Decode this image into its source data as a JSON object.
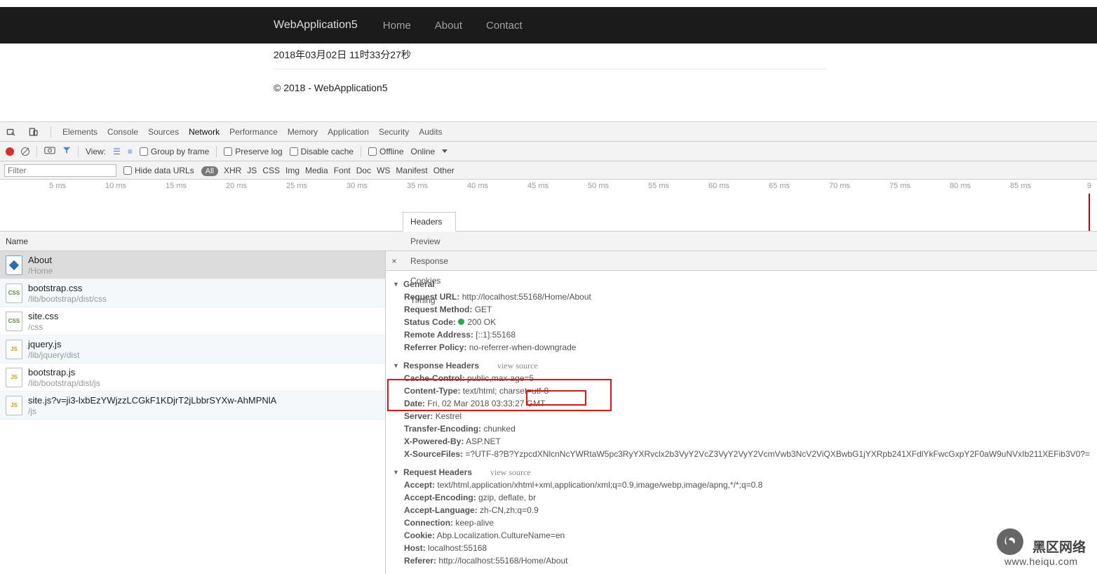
{
  "app": {
    "brand": "WebApplication5",
    "nav": [
      "Home",
      "About",
      "Contact"
    ],
    "timestamp": "2018年03月02日 11时33分27秒",
    "footer": "© 2018 - WebApplication5"
  },
  "devtools": {
    "tabs": [
      "Elements",
      "Console",
      "Sources",
      "Network",
      "Performance",
      "Memory",
      "Application",
      "Security",
      "Audits"
    ],
    "active_tab": "Network",
    "toolbar": {
      "view_label": "View:",
      "group_by_frame": "Group by frame",
      "preserve_log": "Preserve log",
      "disable_cache": "Disable cache",
      "offline": "Offline",
      "online": "Online"
    },
    "filter": {
      "placeholder": "Filter",
      "hide_data_urls": "Hide data URLs",
      "types": [
        "All",
        "XHR",
        "JS",
        "CSS",
        "Img",
        "Media",
        "Font",
        "Doc",
        "WS",
        "Manifest",
        "Other"
      ],
      "active_type": "All"
    },
    "timeline": [
      "5 ms",
      "10 ms",
      "15 ms",
      "20 ms",
      "25 ms",
      "30 ms",
      "35 ms",
      "40 ms",
      "45 ms",
      "50 ms",
      "55 ms",
      "60 ms",
      "65 ms",
      "70 ms",
      "75 ms",
      "80 ms",
      "85 ms",
      "9"
    ],
    "name_header": "Name",
    "requests": [
      {
        "name": "About",
        "sub": "/Home",
        "type": "doc"
      },
      {
        "name": "bootstrap.css",
        "sub": "/lib/bootstrap/dist/css",
        "type": "css"
      },
      {
        "name": "site.css",
        "sub": "/css",
        "type": "css"
      },
      {
        "name": "jquery.js",
        "sub": "/lib/jquery/dist",
        "type": "js"
      },
      {
        "name": "bootstrap.js",
        "sub": "/lib/bootstrap/dist/js",
        "type": "js"
      },
      {
        "name": "site.js?v=ji3-lxbEzYWjzzLCGkF1KDjrT2jLbbrSYXw-AhMPNlA",
        "sub": "/js",
        "type": "js"
      }
    ],
    "right_tabs": [
      "Headers",
      "Preview",
      "Response",
      "Cookies",
      "Timing"
    ],
    "right_active": "Headers",
    "general_label": "General",
    "general": [
      {
        "k": "Request URL:",
        "v": "http://localhost:55168/Home/About"
      },
      {
        "k": "Request Method:",
        "v": "GET"
      },
      {
        "k": "Status Code:",
        "v": "200 OK",
        "dot": true
      },
      {
        "k": "Remote Address:",
        "v": "[::1]:55168"
      },
      {
        "k": "Referrer Policy:",
        "v": "no-referrer-when-downgrade"
      }
    ],
    "resp_label": "Response Headers",
    "view_source": "view source",
    "resp": [
      {
        "k": "Cache-Control:",
        "v": "public,max-age=5"
      },
      {
        "k": "Content-Type:",
        "v": "text/html; charset=utf-8"
      },
      {
        "k": "Date:",
        "v": "Fri, 02 Mar 2018 03:33:27 GMT"
      },
      {
        "k": "Server:",
        "v": "Kestrel"
      },
      {
        "k": "Transfer-Encoding:",
        "v": "chunked"
      },
      {
        "k": "X-Powered-By:",
        "v": "ASP.NET"
      },
      {
        "k": "X-SourceFiles:",
        "v": "=?UTF-8?B?YzpcdXNlcnNcYWRtaW5pc3RyYXRvclx2b3VyY2VcZ3VyY2VyY2VcmVwb3NcV2ViQXBwbG1jYXRpb241XFdlYkFwcGxpY2F0aW9uNVxIb211XEFib3V0?="
      }
    ],
    "req_label": "Request Headers",
    "req": [
      {
        "k": "Accept:",
        "v": "text/html,application/xhtml+xml,application/xml;q=0.9,image/webp,image/apng,*/*;q=0.8"
      },
      {
        "k": "Accept-Encoding:",
        "v": "gzip, deflate, br"
      },
      {
        "k": "Accept-Language:",
        "v": "zh-CN,zh;q=0.9"
      },
      {
        "k": "Connection:",
        "v": "keep-alive"
      },
      {
        "k": "Cookie:",
        "v": "Abp.Localization.CultureName=en"
      },
      {
        "k": "Host:",
        "v": "localhost:55168"
      },
      {
        "k": "Referer:",
        "v": "http://localhost:55168/Home/About"
      }
    ]
  },
  "watermark": {
    "cn": "黑区网络",
    "url": "www.heiqu.com"
  }
}
